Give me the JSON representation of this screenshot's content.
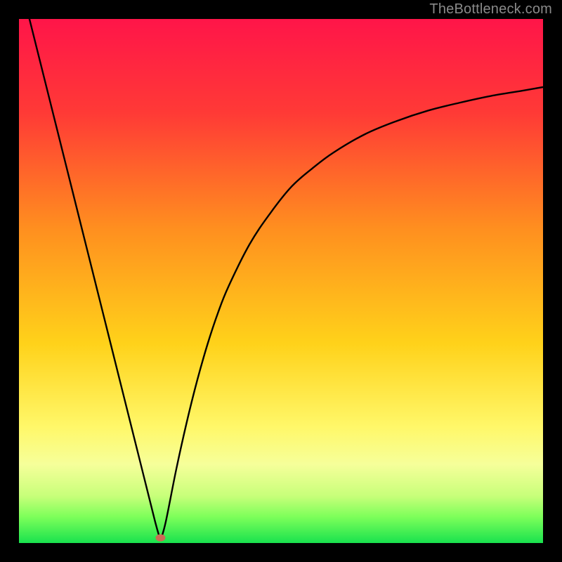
{
  "watermark": "TheBottleneck.com",
  "chart_data": {
    "type": "line",
    "title": "",
    "xlabel": "",
    "ylabel": "",
    "xlim": [
      0,
      100
    ],
    "ylim": [
      0,
      100
    ],
    "gradient_stops": [
      {
        "offset": 0,
        "color": "#ff1549"
      },
      {
        "offset": 18,
        "color": "#ff3a36"
      },
      {
        "offset": 40,
        "color": "#ff8f1f"
      },
      {
        "offset": 62,
        "color": "#ffd21a"
      },
      {
        "offset": 78,
        "color": "#fff86a"
      },
      {
        "offset": 85,
        "color": "#f6ff9a"
      },
      {
        "offset": 91,
        "color": "#c8ff7a"
      },
      {
        "offset": 95,
        "color": "#7dff5a"
      },
      {
        "offset": 100,
        "color": "#19e24e"
      }
    ],
    "min_x": 27,
    "marker": {
      "x": 27,
      "y": 99,
      "color": "#cc6b55"
    },
    "series": [
      {
        "name": "left-branch",
        "x": [
          2,
          4,
          6,
          8,
          10,
          12,
          14,
          16,
          18,
          20,
          22,
          24,
          26,
          27
        ],
        "y": [
          100,
          92,
          84,
          76,
          68,
          60,
          52,
          44,
          36,
          28,
          20,
          12,
          4,
          0.5
        ]
      },
      {
        "name": "right-branch",
        "x": [
          27,
          28,
          30,
          32,
          34,
          36,
          38,
          40,
          44,
          48,
          52,
          56,
          60,
          66,
          72,
          78,
          84,
          90,
          96,
          100
        ],
        "y": [
          0.5,
          4,
          14,
          23,
          31,
          38,
          44,
          49,
          57,
          63,
          68,
          71.5,
          74.5,
          78,
          80.5,
          82.5,
          84,
          85.3,
          86.3,
          87
        ]
      }
    ]
  }
}
